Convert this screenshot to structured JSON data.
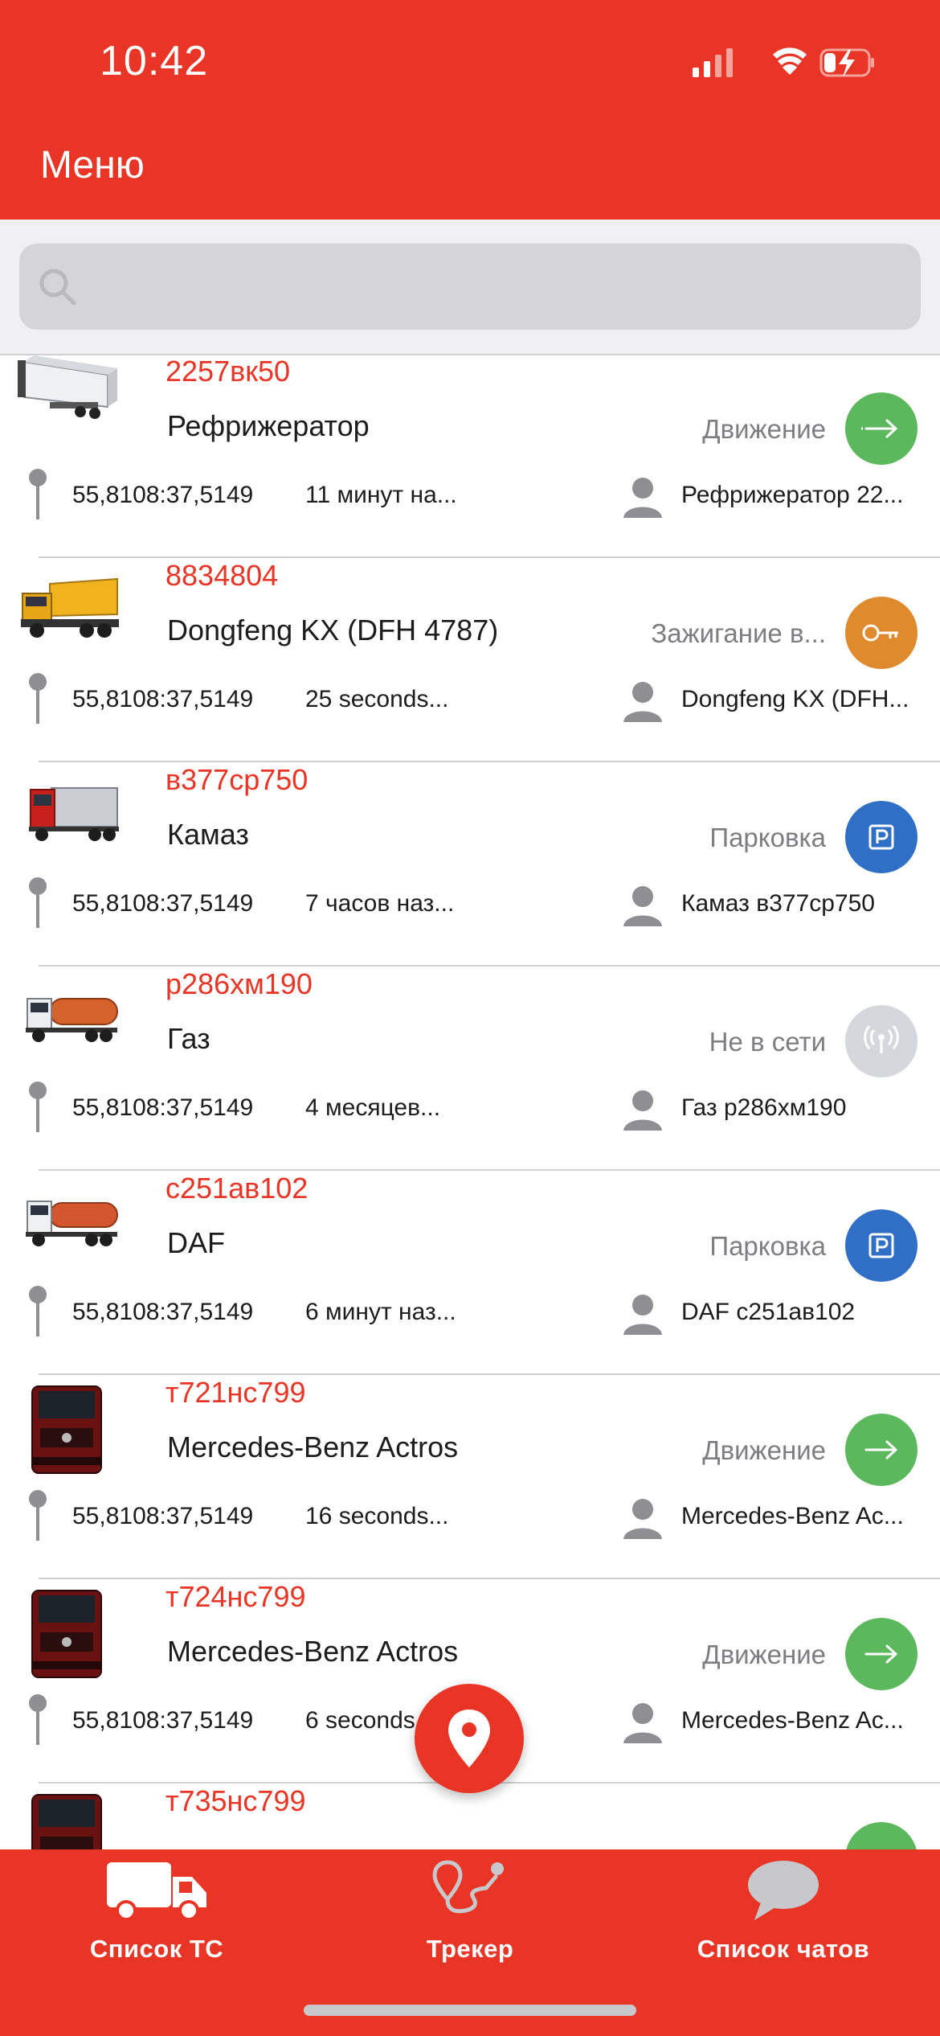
{
  "status_bar": {
    "time": "10:42"
  },
  "header": {
    "title": "Меню"
  },
  "search": {
    "placeholder": ""
  },
  "vehicles": [
    {
      "plate": "2257вк50",
      "name": "Рефрижератор",
      "status": "Движение",
      "status_icon": "arrow-right-icon",
      "status_color": "#5cb85c",
      "coords": "55,8108:37,5149",
      "time": "11 минут на...",
      "driver": "Рефрижератор 22..."
    },
    {
      "plate": "8834804",
      "name": "Dongfeng KX (DFH 4787)",
      "status": "Зажигание в...",
      "status_icon": "key-icon",
      "status_color": "#e08a2e",
      "coords": "55,8108:37,5149",
      "time": "25 seconds...",
      "driver": "Dongfeng KX (DFH..."
    },
    {
      "plate": "в377ср750",
      "name": "Камаз",
      "status": "Парковка",
      "status_icon": "parking-icon",
      "status_color": "#2f6fc6",
      "coords": "55,8108:37,5149",
      "time": "7 часов наз...",
      "driver": "Камаз в377ср750"
    },
    {
      "plate": "р286хм190",
      "name": "Газ",
      "status": "Не в сети",
      "status_icon": "antenna-icon",
      "status_color": "#d4d8dc",
      "coords": "55,8108:37,5149",
      "time": "4 месяцев...",
      "driver": "Газ р286хм190"
    },
    {
      "plate": "с251ав102",
      "name": "DAF",
      "status": "Парковка",
      "status_icon": "parking-icon",
      "status_color": "#2f6fc6",
      "coords": "55,8108:37,5149",
      "time": "6 минут наз...",
      "driver": "DAF с251ав102"
    },
    {
      "plate": "т721нс799",
      "name": "Mercedes-Benz Actros",
      "status": "Движение",
      "status_icon": "arrow-right-icon",
      "status_color": "#5cb85c",
      "coords": "55,8108:37,5149",
      "time": "16 seconds...",
      "driver": "Mercedes-Benz Ac..."
    },
    {
      "plate": "т724нс799",
      "name": "Mercedes-Benz Actros",
      "status": "Движение",
      "status_icon": "arrow-right-icon",
      "status_color": "#5cb85c",
      "coords": "55,8108:37,5149",
      "time": "6 seconds...",
      "driver": "Mercedes-Benz Ac..."
    },
    {
      "plate": "т735нс799",
      "name": "",
      "status": "",
      "status_icon": "arrow-right-icon",
      "status_color": "#5cb85c",
      "coords": "",
      "time": "",
      "driver": ""
    }
  ],
  "fab": {
    "icon": "map-pin-icon"
  },
  "tabs": [
    {
      "label": "Список ТС",
      "icon": "truck-icon"
    },
    {
      "label": "Трекер",
      "icon": "route-icon"
    },
    {
      "label": "Список чатов",
      "icon": "chat-bubble-icon"
    }
  ],
  "colors": {
    "brand": "#e93525",
    "plate_text": "#e93525",
    "moving": "#5cb85c",
    "ignition": "#e08a2e",
    "parking": "#2f6fc6",
    "offline": "#d4d8dc"
  }
}
